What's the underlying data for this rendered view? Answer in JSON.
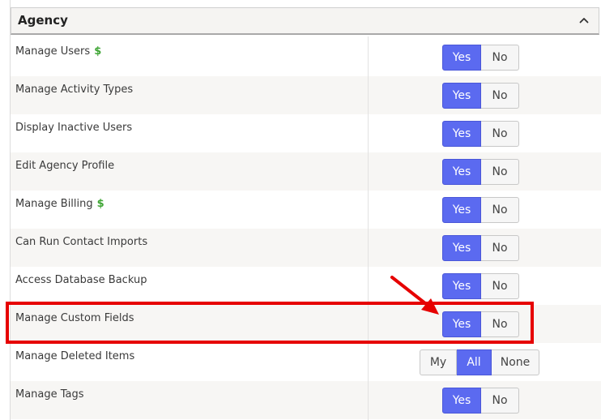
{
  "section": {
    "title": "Agency"
  },
  "icons": {
    "collapse": "chevron-up-icon",
    "dollar": "dollar-sign-icon"
  },
  "colors": {
    "active": "#5b6af0",
    "highlight": "#e60000",
    "dollar": "#3fa535"
  },
  "rows": [
    {
      "label": "Manage Users",
      "dollar": "$",
      "options": [
        "Yes",
        "No"
      ],
      "selected": "Yes"
    },
    {
      "label": "Manage Activity Types",
      "options": [
        "Yes",
        "No"
      ],
      "selected": "Yes"
    },
    {
      "label": "Display Inactive Users",
      "options": [
        "Yes",
        "No"
      ],
      "selected": "Yes"
    },
    {
      "label": "Edit Agency Profile",
      "options": [
        "Yes",
        "No"
      ],
      "selected": "Yes"
    },
    {
      "label": "Manage Billing",
      "dollar": "$",
      "options": [
        "Yes",
        "No"
      ],
      "selected": "Yes"
    },
    {
      "label": "Can Run Contact Imports",
      "options": [
        "Yes",
        "No"
      ],
      "selected": "Yes"
    },
    {
      "label": "Access Database Backup",
      "options": [
        "Yes",
        "No"
      ],
      "selected": "Yes"
    },
    {
      "label": "Manage Custom Fields",
      "options": [
        "Yes",
        "No"
      ],
      "selected": "Yes"
    },
    {
      "label": "Manage Deleted Items",
      "options": [
        "My",
        "All",
        "None"
      ],
      "selected": "All"
    },
    {
      "label": "Manage Tags",
      "options": [
        "Yes",
        "No"
      ],
      "selected": "Yes"
    }
  ]
}
